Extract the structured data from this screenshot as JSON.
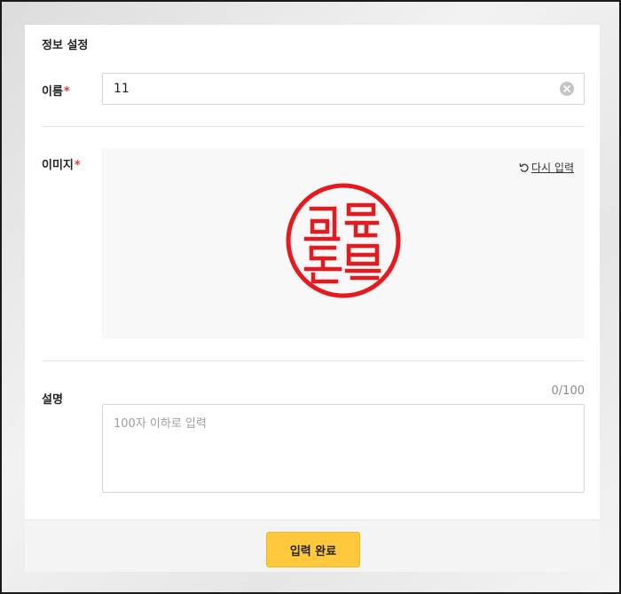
{
  "form": {
    "section_title": "정보 설정",
    "required_mark": "*",
    "name": {
      "label": "이름",
      "value": "11",
      "clear_icon": "clear-circle-icon"
    },
    "image": {
      "label": "이미지",
      "reenter_label": "다시 입력",
      "reenter_icon": "undo-icon",
      "seal_color": "#e8191c"
    },
    "description": {
      "label": "설명",
      "counter": "0/100",
      "placeholder": "100자 이하로 입력",
      "value": ""
    },
    "submit_label": "입력 완료"
  },
  "colors": {
    "accent": "#ffc83d",
    "required": "#e53935"
  }
}
